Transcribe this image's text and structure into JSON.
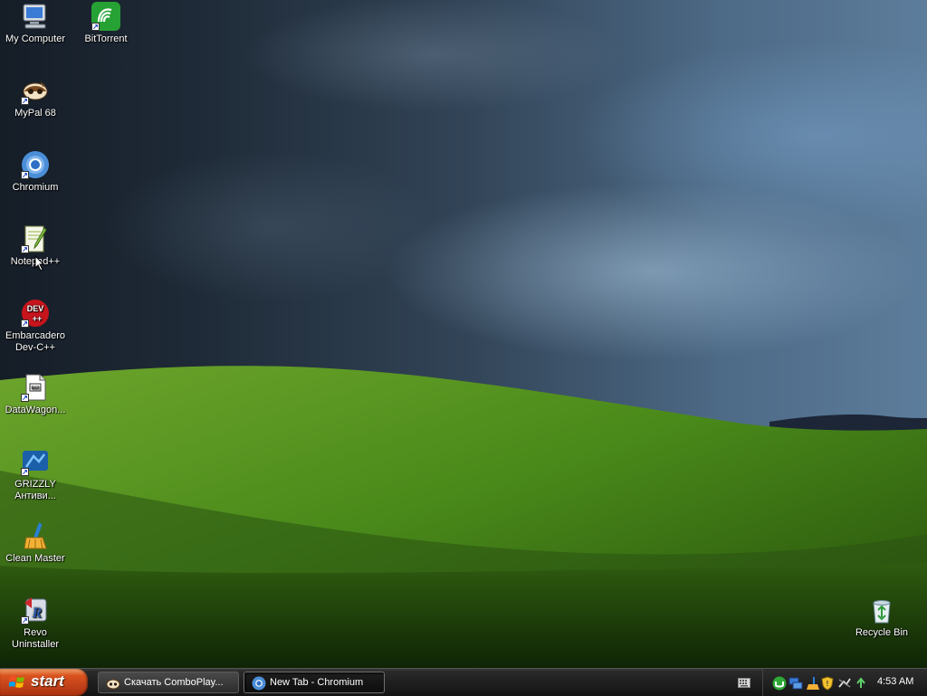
{
  "desktop": {
    "icons_left": [
      {
        "id": "my-computer",
        "label": "My Computer",
        "shortcut": false
      },
      {
        "id": "mypal",
        "label": "MyPal 68",
        "shortcut": true
      },
      {
        "id": "chromium",
        "label": "Chromium",
        "shortcut": true
      },
      {
        "id": "notepadpp",
        "label": "Notepad++",
        "shortcut": true
      },
      {
        "id": "devcpp",
        "label_line1": "Embarcadero",
        "label_line2": "Dev-C++",
        "shortcut": true
      },
      {
        "id": "datawagon",
        "label": "DataWagon...",
        "shortcut": true
      },
      {
        "id": "grizzly",
        "label_line1": "GRIZZLY",
        "label_line2": "Антиви...",
        "shortcut": true
      },
      {
        "id": "cleanmaster",
        "label": "Clean Master",
        "shortcut": false
      },
      {
        "id": "revo",
        "label_line1": "Revo",
        "label_line2": "Uninstaller",
        "shortcut": true
      }
    ],
    "bittorrent": {
      "label": "BitTorrent",
      "shortcut": true
    },
    "recycle_bin": {
      "label": "Recycle Bin"
    }
  },
  "taskbar": {
    "start_label": "start",
    "tasks": [
      {
        "label": "Скачать ComboPlay...",
        "active": false,
        "icon": "mypal-icon"
      },
      {
        "label": "New Tab - Chromium",
        "active": true,
        "icon": "chromium-icon"
      }
    ],
    "keyboard_icon": "keyboard-icon",
    "tray_icons": [
      "utorrent-icon",
      "network-icon",
      "clean-master-icon",
      "security-shield-icon",
      "connection-icon",
      "recycle-tray-icon"
    ],
    "clock": "4:53 AM"
  },
  "colors": {
    "start_button": "#d9531e",
    "taskbar": "#1f1f1f",
    "sky": "#324457",
    "hill": "#4f8a1f"
  }
}
